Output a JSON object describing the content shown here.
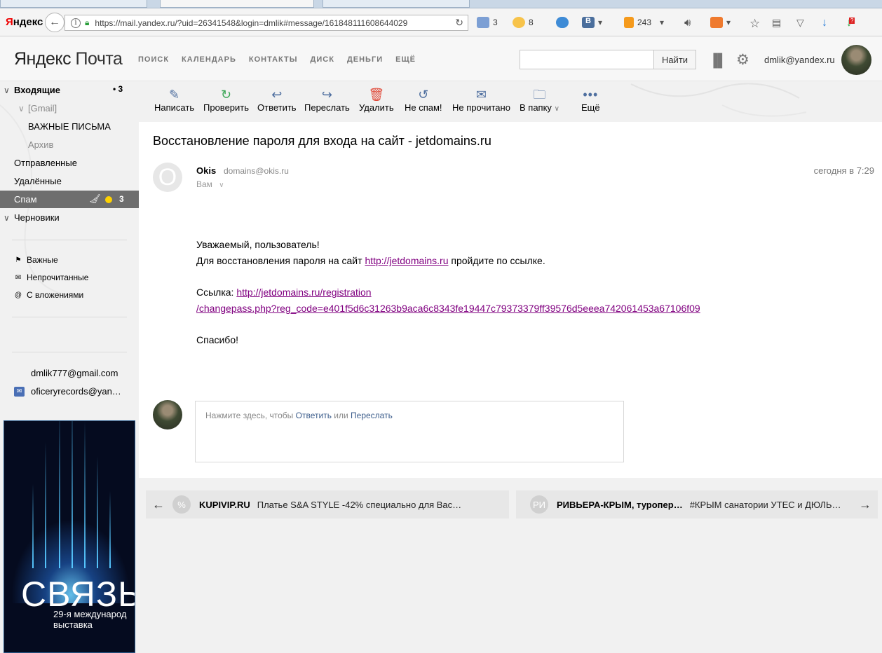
{
  "browser": {
    "brand_left": "Я",
    "brand_rest": "ндекс",
    "url": "https://mail.yandex.ru/?uid=26341548&login=dmlik#message/161848111608644029",
    "ext_mail_count": "3",
    "ext_weather": "8",
    "ext_ok_count": "243",
    "ext_badge": "?"
  },
  "header": {
    "logo_bold": "Яндекс",
    "logo_light": "Почта",
    "nav": [
      "ПОИСК",
      "КАЛЕНДАРЬ",
      "КОНТАКТЫ",
      "ДИСК",
      "ДЕНЬГИ",
      "ЕЩЁ"
    ],
    "search_button": "Найти",
    "user_email": "dmlik@yandex.ru"
  },
  "sidebar": {
    "inbox": "Входящие",
    "inbox_count": "3",
    "gmail": "[Gmail]",
    "important_letters": "ВАЖНЫЕ ПИСЬМА",
    "archive": "Архив",
    "sent": "Отправленные",
    "deleted": "Удалённые",
    "spam": "Спам",
    "spam_count": "3",
    "drafts": "Черновики",
    "filters": [
      "Важные",
      "Непрочитанные",
      "С вложениями"
    ],
    "accounts": [
      "dmlik777@gmail.com",
      "oficeryrecords@yan…"
    ]
  },
  "ad": {
    "big": "СВЯЗЬ",
    "line1": "29-я международ",
    "line2": "выставка"
  },
  "toolbar": {
    "write": "Написать",
    "check": "Проверить",
    "reply": "Ответить",
    "forward": "Переслать",
    "delete": "Удалить",
    "not_spam": "Не спам!",
    "unread": "Не прочитано",
    "to_folder": "В папку",
    "more": "Ещё"
  },
  "message": {
    "subject": "Восстановление пароля для входа на сайт - jetdomains.ru",
    "sender_initial": "O",
    "sender_name": "Okis",
    "sender_email": "domains@okis.ru",
    "to": "Вам",
    "date": "сегодня в 7:29",
    "greeting": "Уважаемый, пользователь!",
    "line2_pre": "Для восстановления пароля на сайт ",
    "line2_link": "http://jetdomains.ru",
    "line2_post": " пройдите по ссылке.",
    "link_label": "Ссылка: ",
    "link_part1": "http://jetdomains.ru/registration",
    "link_part2": "/changepass.php?reg_code=e401f5d6c31263b9aca6c8343fe19447c79373379ff39576d5eeea742061453a67106f09",
    "thanks": "Спасибо!"
  },
  "reply": {
    "prefix": "Нажмите здесь, чтобы ",
    "reply_link": "Ответить",
    "or": " или ",
    "forward_link": "Переслать"
  },
  "promos": [
    {
      "initial": "%",
      "brand": "KUPIVIP.RU",
      "text": "Платье S&A STYLE -42% специально для Вас…"
    },
    {
      "initial": "РИ",
      "brand": "РИВЬЕРА-КРЫМ, туропер…",
      "text": "#КРЫМ санатории УТЕС и ДЮЛЬ…"
    }
  ]
}
